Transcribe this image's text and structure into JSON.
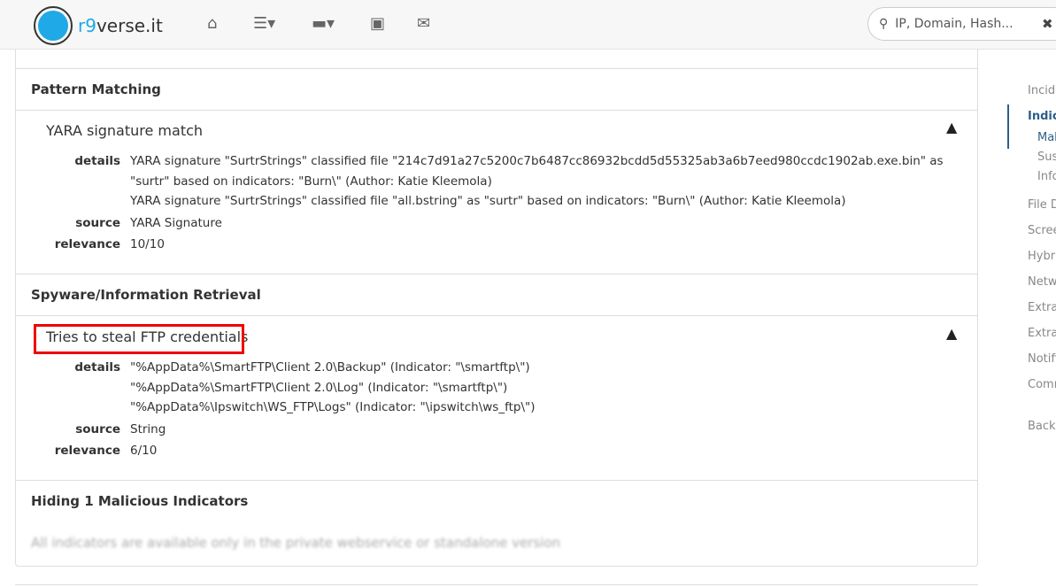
{
  "nav": {
    "brand_prefix": "r9",
    "brand_suffix": "verse.it",
    "search_placeholder": "IP, Domain, Hash...",
    "icons": [
      "home-icon",
      "list-icon",
      "folder-icon",
      "contact-card-icon",
      "envelope-icon"
    ]
  },
  "sections": [
    {
      "title": "Pattern Matching",
      "indicator": {
        "title": "YARA signature match",
        "details": [
          "YARA signature \"SurtrStrings\" classified file \"214c7d91a27c5200c7b6487cc86932bcdd5d55325ab3a6b7eed980ccdc1902ab.exe.bin\" as \"surtr\" based on indicators: \"Burn\\\" (Author: Katie Kleemola)",
          "YARA signature \"SurtrStrings\" classified file \"all.bstring\" as \"surtr\" based on indicators: \"Burn\\\" (Author: Katie Kleemola)"
        ],
        "source": "YARA Signature",
        "relevance": "10/10"
      }
    },
    {
      "title": "Spyware/Information Retrieval",
      "indicator": {
        "title": "Tries to steal FTP credentials",
        "details": [
          "\"%AppData%\\SmartFTP\\Client 2.0\\Backup\" (Indicator: \"\\smartftp\\\")",
          "\"%AppData%\\SmartFTP\\Client 2.0\\Log\" (Indicator: \"\\smartftp\\\")",
          "\"%AppData%\\Ipswitch\\WS_FTP\\Logs\" (Indicator: \"\\ipswitch\\ws_ftp\\\")"
        ],
        "source": "String",
        "relevance": "6/10"
      }
    },
    {
      "title": "Hiding 1 Malicious Indicators",
      "note": "All indicators are available only in the private webservice or standalone version"
    }
  ],
  "labels": {
    "details": "details",
    "source": "source",
    "relevance": "relevance"
  },
  "toc": [
    "Incide",
    "Indica",
    "Mal",
    "Sus",
    "Info",
    "File D",
    "Scree",
    "Hybri",
    "Netw",
    "Extra",
    "Extra",
    "Notifi",
    "Comm",
    "Back t"
  ]
}
